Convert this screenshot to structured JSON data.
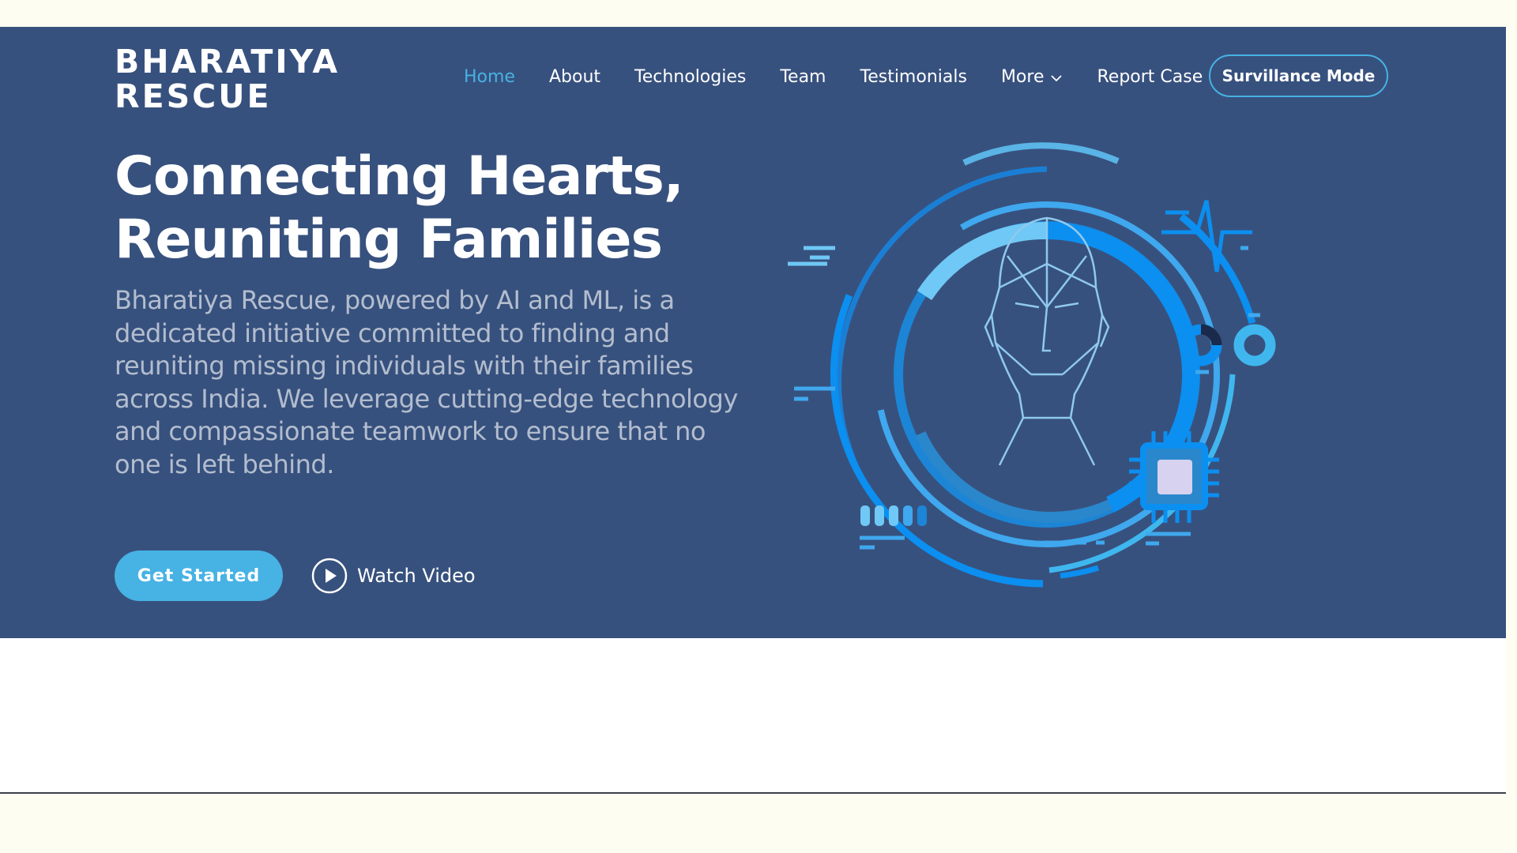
{
  "brand": {
    "line1": "BHARATIYA",
    "line2": "RESCUE"
  },
  "nav": {
    "items": [
      {
        "label": "Home",
        "active": true
      },
      {
        "label": "About"
      },
      {
        "label": "Technologies"
      },
      {
        "label": "Team"
      },
      {
        "label": "Testimonials"
      },
      {
        "label": "More",
        "has_dropdown": true
      },
      {
        "label": "Report Case"
      }
    ],
    "surveillance_label": "Survillance Mode"
  },
  "hero": {
    "headline_line1": "Connecting Hearts,",
    "headline_line2": "Reuniting Families",
    "description": "Bharatiya Rescue, powered by AI and ML, is a dedicated initiative committed to finding and reuniting missing individuals with their families across India. We leverage cutting-edge technology and compassionate teamwork to ensure that no one is left behind.",
    "primary_cta": "Get Started",
    "secondary_cta": "Watch Video"
  },
  "colors": {
    "hero_bg": "#37517e",
    "accent": "#47b2e4",
    "page_bg": "#fdfdf1"
  },
  "icons": [
    "chevron-down-icon",
    "play-icon",
    "face-scan-illustration"
  ]
}
